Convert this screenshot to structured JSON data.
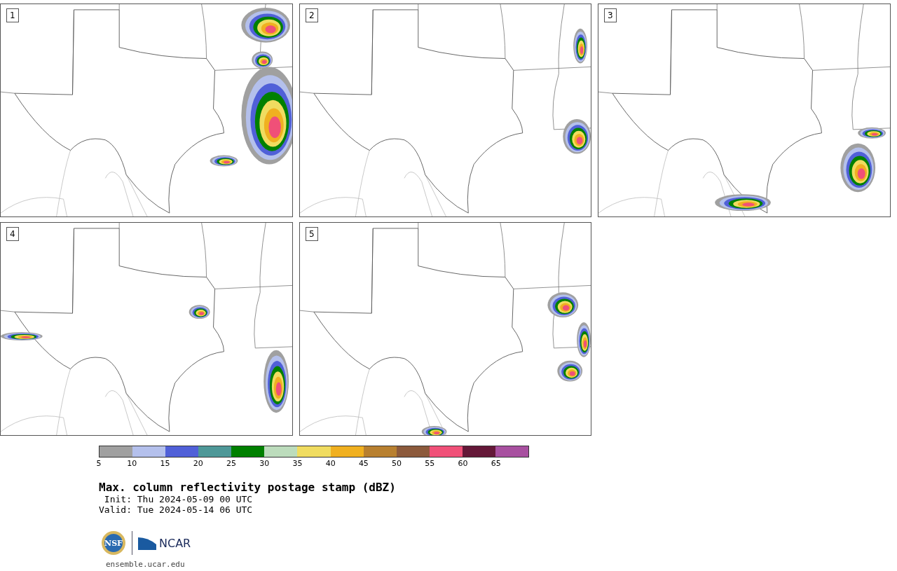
{
  "panels": [
    {
      "label": "1"
    },
    {
      "label": "2"
    },
    {
      "label": "3"
    },
    {
      "label": "4"
    },
    {
      "label": "5"
    }
  ],
  "legend": {
    "bins": [
      {
        "color": "#a0a0a0"
      },
      {
        "color": "#b4c0ec"
      },
      {
        "color": "#5060d8"
      },
      {
        "color": "#4e9898"
      },
      {
        "color": "#008000"
      },
      {
        "color": "#bcdcbc"
      },
      {
        "color": "#f0dc60"
      },
      {
        "color": "#f0b020"
      },
      {
        "color": "#b88030"
      },
      {
        "color": "#8c5a3c"
      },
      {
        "color": "#f05078"
      },
      {
        "color": "#641838"
      },
      {
        "color": "#a850a0"
      }
    ],
    "ticks": [
      "5",
      "10",
      "15",
      "20",
      "25",
      "30",
      "35",
      "40",
      "45",
      "50",
      "55",
      "60",
      "65"
    ]
  },
  "title": "Max. column reflectivity postage stamp (dBZ)",
  "init": " Init: Thu 2024-05-09 00 UTC",
  "valid": "Valid: Tue 2024-05-14 06 UTC",
  "logos": {
    "nsf": "NSF",
    "ncar": "NCAR"
  },
  "url": "ensemble.ucar.edu"
}
